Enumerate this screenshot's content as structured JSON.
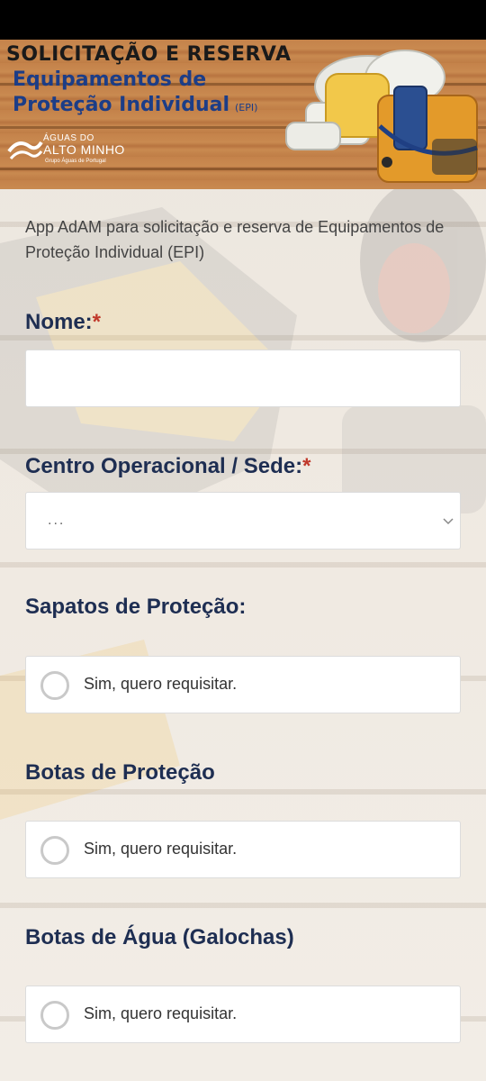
{
  "banner": {
    "title_line1": "SOLICITAÇÃO E RESERVA",
    "title_line2": "Equipamentos de",
    "title_line3": "Proteção Individual",
    "title_abbrev": "(EPI)",
    "logo": {
      "top": "ÁGUAS DO",
      "main": "ALTO MINHO",
      "sub": "Grupo Águas de Portugal"
    }
  },
  "intro": "App AdAM para solicitação e reserva de Equipamentos de Proteção Individual (EPI)",
  "form": {
    "required_mark": "*",
    "nome": {
      "label": "Nome:",
      "value": ""
    },
    "centro": {
      "label": "Centro Operacional / Sede:",
      "selected": "..."
    },
    "sapatos": {
      "label": "Sapatos de Proteção:",
      "option": "Sim, quero requisitar."
    },
    "botas": {
      "label": "Botas de Proteção",
      "option": "Sim, quero requisitar."
    },
    "galochas": {
      "label": "Botas de Água (Galochas)",
      "option": "Sim, quero requisitar."
    }
  },
  "colors": {
    "label": "#1e2e52",
    "required": "#c0392b",
    "banner_title": "#1c3d87"
  }
}
